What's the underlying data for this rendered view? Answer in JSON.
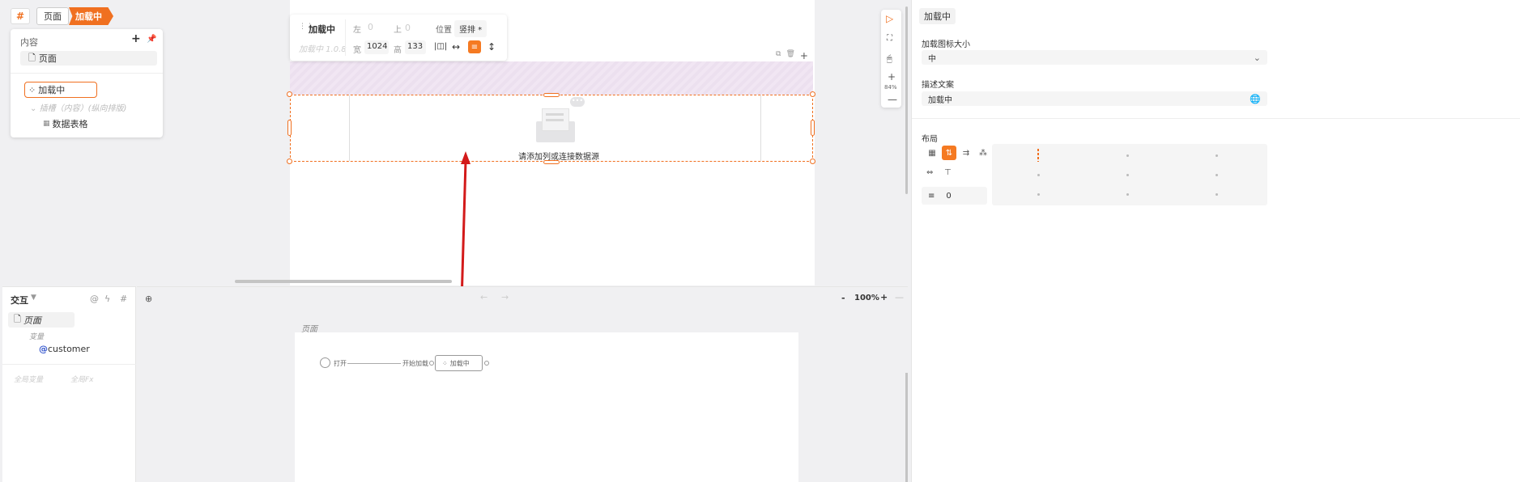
{
  "breadcrumb": {
    "hash": "#",
    "page": "页面",
    "current": "加载中"
  },
  "outline": {
    "title": "内容",
    "page_item": "页面",
    "selected": "加载中",
    "group": "插槽（内容）(纵向排版)",
    "table": "数据表格"
  },
  "toolbar": {
    "name": "加载中",
    "version": "加载中 1.0.8",
    "left_label": "左",
    "left_value": "0",
    "top_label": "上",
    "top_value": "0",
    "position_label": "位置",
    "position_value": "竖排 *",
    "width_label": "宽",
    "width_value": "1024",
    "height_label": "高",
    "height_value": "133"
  },
  "canvas": {
    "empty_text": "请添加列或连接数据源"
  },
  "rightbar": {
    "zoom": "84%"
  },
  "interaction": {
    "title": "交互",
    "page_item": "页面",
    "variables_label": "变量",
    "variable": "customer",
    "global_vars": "全局变量",
    "global_fx": "全局Fx"
  },
  "flow": {
    "zoom": "100%",
    "page_label": "页面",
    "open": "打开",
    "start_load": "开始加载",
    "loading": "加载中"
  },
  "props": {
    "tag": "加载中",
    "icon_size_label": "加载图标大小",
    "icon_size_value": "中",
    "desc_label": "描述文案",
    "desc_value": "加载中",
    "layout_label": "布局",
    "gap_value": "0"
  }
}
